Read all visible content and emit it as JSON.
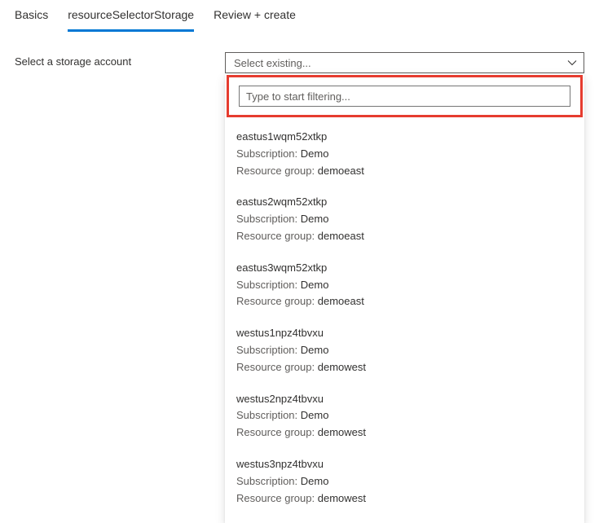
{
  "tabs": {
    "items": [
      {
        "label": "Basics"
      },
      {
        "label": "resourceSelectorStorage"
      },
      {
        "label": "Review + create"
      }
    ],
    "activeIndex": 1
  },
  "form": {
    "label": "Select a storage account"
  },
  "select": {
    "placeholder": "Select existing...",
    "filterPlaceholder": "Type to start filtering..."
  },
  "meta_labels": {
    "subscription": "Subscription:",
    "resourceGroup": "Resource group:"
  },
  "options": [
    {
      "name": "eastus1wqm52xtkp",
      "subscription": "Demo",
      "resourceGroup": "demoeast"
    },
    {
      "name": "eastus2wqm52xtkp",
      "subscription": "Demo",
      "resourceGroup": "demoeast"
    },
    {
      "name": "eastus3wqm52xtkp",
      "subscription": "Demo",
      "resourceGroup": "demoeast"
    },
    {
      "name": "westus1npz4tbvxu",
      "subscription": "Demo",
      "resourceGroup": "demowest"
    },
    {
      "name": "westus2npz4tbvxu",
      "subscription": "Demo",
      "resourceGroup": "demowest"
    },
    {
      "name": "westus3npz4tbvxu",
      "subscription": "Demo",
      "resourceGroup": "demowest"
    }
  ]
}
